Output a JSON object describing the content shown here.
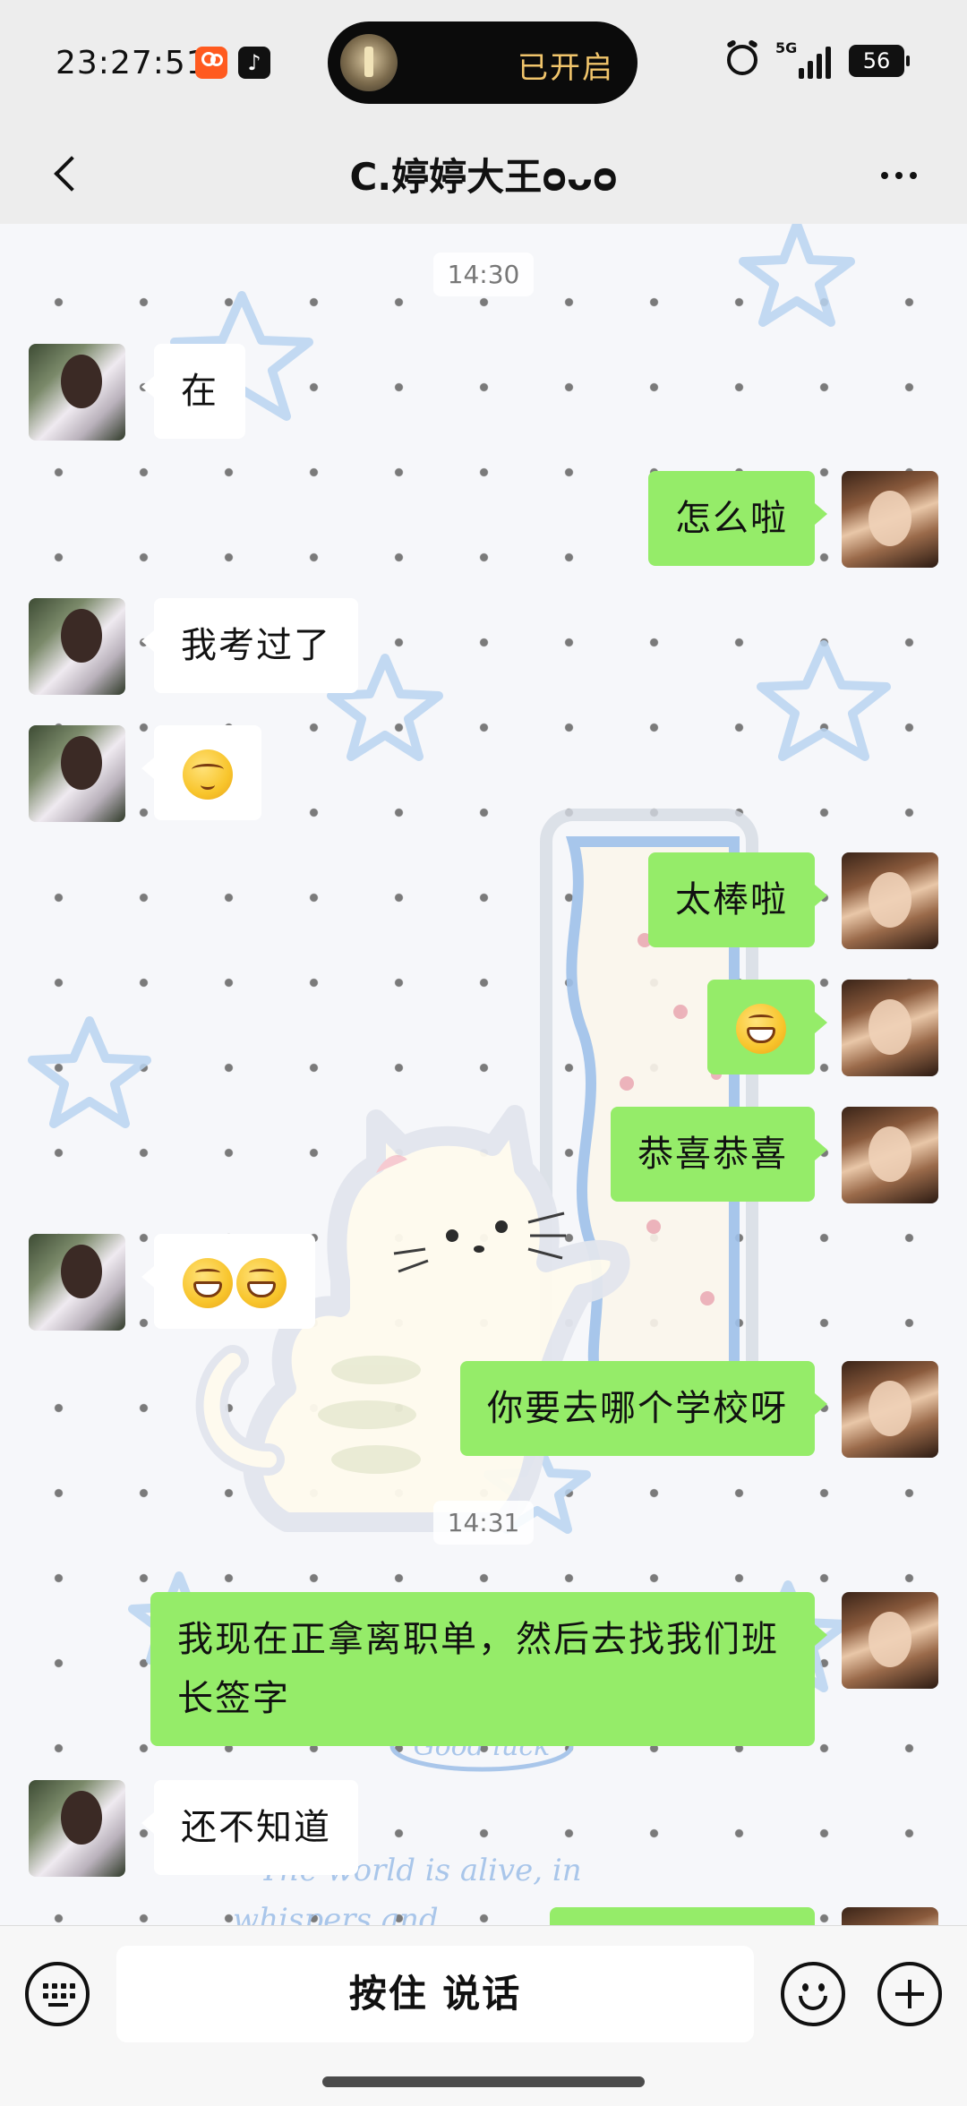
{
  "status_bar": {
    "time": "23:27:51",
    "island_label": "已开启",
    "network": "5G",
    "battery": "56"
  },
  "header": {
    "title": "C.婷婷大王ᴑᴗᴑ"
  },
  "messages": [
    {
      "type": "time",
      "text": "14:30"
    },
    {
      "side": "left",
      "text": "在"
    },
    {
      "side": "right",
      "text": "怎么啦"
    },
    {
      "side": "left",
      "text": "我考过了"
    },
    {
      "side": "left",
      "emoji": [
        "shy"
      ]
    },
    {
      "side": "right",
      "text": "太棒啦"
    },
    {
      "side": "right",
      "emoji": [
        "grin"
      ]
    },
    {
      "side": "right",
      "text": "恭喜恭喜"
    },
    {
      "side": "left",
      "emoji": [
        "grin",
        "grin"
      ]
    },
    {
      "side": "right",
      "text": "你要去哪个学校呀"
    },
    {
      "type": "time",
      "text": "14:31"
    },
    {
      "side": "right",
      "text": "我现在正拿离职单，然后去找我们班长签字"
    },
    {
      "side": "left",
      "text": "还不知道"
    }
  ],
  "wallpaper": {
    "text_1": "Good luck",
    "text_2": "The world is alive, in",
    "text_3": "whispers and"
  },
  "input_bar": {
    "talk_label": "按住 说话"
  },
  "colors": {
    "self_bubble": "#95ec69",
    "other_bubble": "#ffffff",
    "bar_bg": "#ededed"
  }
}
